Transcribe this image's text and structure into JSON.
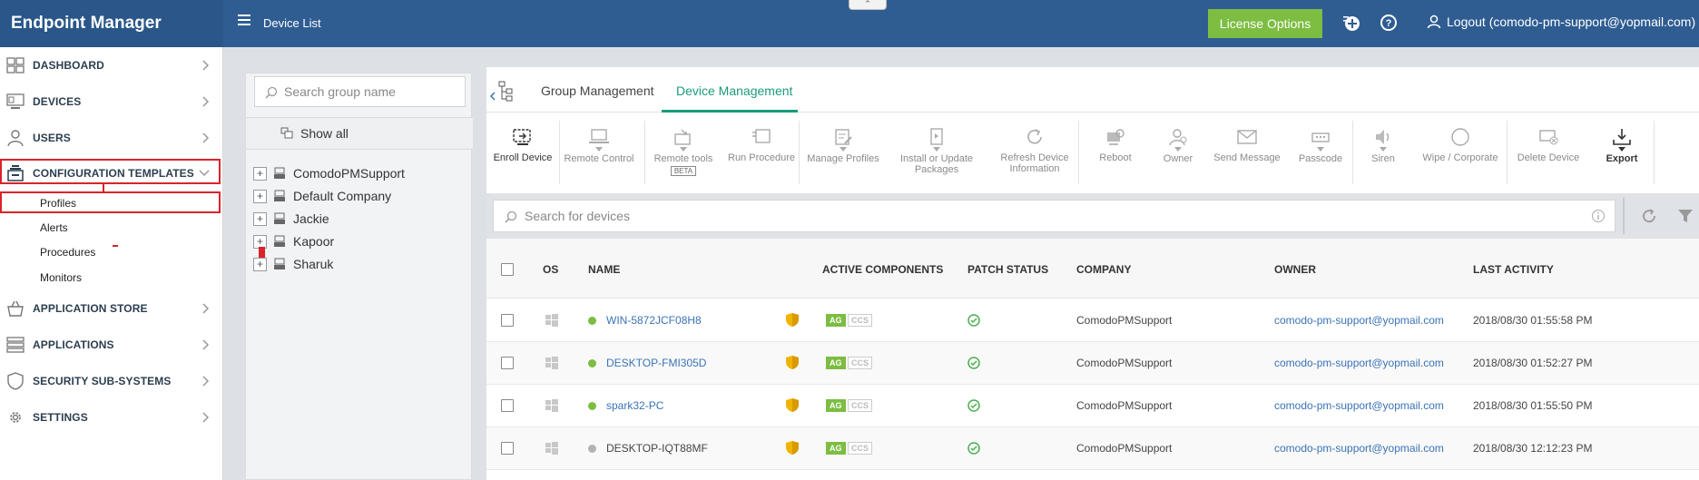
{
  "app": {
    "brand": "Endpoint Manager",
    "page_title": "Device List",
    "collapse_glyph": "⌃"
  },
  "header": {
    "license_label": "License Options",
    "logout_label": "Logout (comodo-pm-support@yopmail.com)",
    "icons": [
      "add-circle-icon",
      "help-icon",
      "user-icon"
    ]
  },
  "sidebar": {
    "items": [
      {
        "label": "DASHBOARD",
        "icon": "dashboard-icon"
      },
      {
        "label": "DEVICES",
        "icon": "devices-icon"
      },
      {
        "label": "USERS",
        "icon": "user-icon"
      },
      {
        "label": "CONFIGURATION TEMPLATES",
        "icon": "templates-icon",
        "expanded": true
      },
      {
        "label": "APPLICATION STORE",
        "icon": "store-icon"
      },
      {
        "label": "APPLICATIONS",
        "icon": "applications-icon"
      },
      {
        "label": "SECURITY SUB-SYSTEMS",
        "icon": "shield-icon"
      },
      {
        "label": "SETTINGS",
        "icon": "gear-icon"
      }
    ],
    "sub_items": [
      "Profiles",
      "Alerts",
      "Procedures",
      "Monitors"
    ]
  },
  "groups": {
    "search_placeholder": "Search group name",
    "show_all": "Show all",
    "list": [
      "ComodoPMSupport",
      "Default Company",
      "Jackie",
      "Kapoor",
      "Sharuk"
    ]
  },
  "tabs": [
    {
      "label": "Group Management",
      "active": false
    },
    {
      "label": "Device Management",
      "active": true
    }
  ],
  "toolbar": [
    {
      "label": "Enroll Device",
      "icon": "enroll-icon",
      "enabled": true
    },
    {
      "label": "Remote Control",
      "icon": "laptop-icon",
      "enabled": false
    },
    {
      "label": "Remote tools",
      "icon": "remote-tools-icon",
      "enabled": false,
      "badge": "BETA"
    },
    {
      "label": "Run Procedure",
      "icon": "run-procedure-icon",
      "enabled": false
    },
    {
      "label": "Manage Profiles",
      "icon": "manage-profiles-icon",
      "enabled": false
    },
    {
      "label": "Install or Update Packages",
      "line1": "Install or Update",
      "line2": "Packages",
      "icon": "package-icon",
      "enabled": false
    },
    {
      "label": "Refresh Device Information",
      "line1": "Refresh Device",
      "line2": "Information",
      "icon": "refresh-icon",
      "enabled": false
    },
    {
      "label": "Reboot",
      "icon": "reboot-icon",
      "enabled": false
    },
    {
      "label": "Owner",
      "icon": "owner-icon",
      "enabled": false
    },
    {
      "label": "Send Message",
      "icon": "envelope-icon",
      "enabled": false
    },
    {
      "label": "Passcode",
      "icon": "passcode-icon",
      "enabled": false
    },
    {
      "label": "Siren",
      "icon": "speaker-icon",
      "enabled": false
    },
    {
      "label": "Wipe / Corporate",
      "icon": "wipe-icon",
      "enabled": false
    },
    {
      "label": "Delete Device",
      "icon": "delete-device-icon",
      "enabled": false
    },
    {
      "label": "Export",
      "icon": "export-icon",
      "enabled": true
    }
  ],
  "device_search": {
    "placeholder": "Search for devices"
  },
  "table": {
    "columns": [
      "OS",
      "NAME",
      "ACTIVE COMPONENTS",
      "PATCH STATUS",
      "COMPANY",
      "OWNER",
      "LAST ACTIVITY"
    ],
    "components": [
      "AG",
      "CCS"
    ],
    "rows": [
      {
        "name": "WIN-5872JCF08H8",
        "online": true,
        "company": "ComodoPMSupport",
        "owner": "comodo-pm-support@yopmail.com",
        "last_activity": "2018/08/30 01:55:58 PM"
      },
      {
        "name": "DESKTOP-FMI305D",
        "online": true,
        "company": "ComodoPMSupport",
        "owner": "comodo-pm-support@yopmail.com",
        "last_activity": "2018/08/30 01:52:27 PM"
      },
      {
        "name": "spark32-PC",
        "online": true,
        "company": "ComodoPMSupport",
        "owner": "comodo-pm-support@yopmail.com",
        "last_activity": "2018/08/30 01:55:50 PM"
      },
      {
        "name": "DESKTOP-IQT88MF",
        "online": false,
        "company": "ComodoPMSupport",
        "owner": "comodo-pm-support@yopmail.com",
        "last_activity": "2018/08/30 12:12:23 PM"
      }
    ]
  },
  "colors": {
    "header": "#2f5d92",
    "accent_green": "#7cbd42",
    "tab_active": "#1a9b7c",
    "highlight_red": "#d9242b",
    "link": "#3a73b6"
  }
}
